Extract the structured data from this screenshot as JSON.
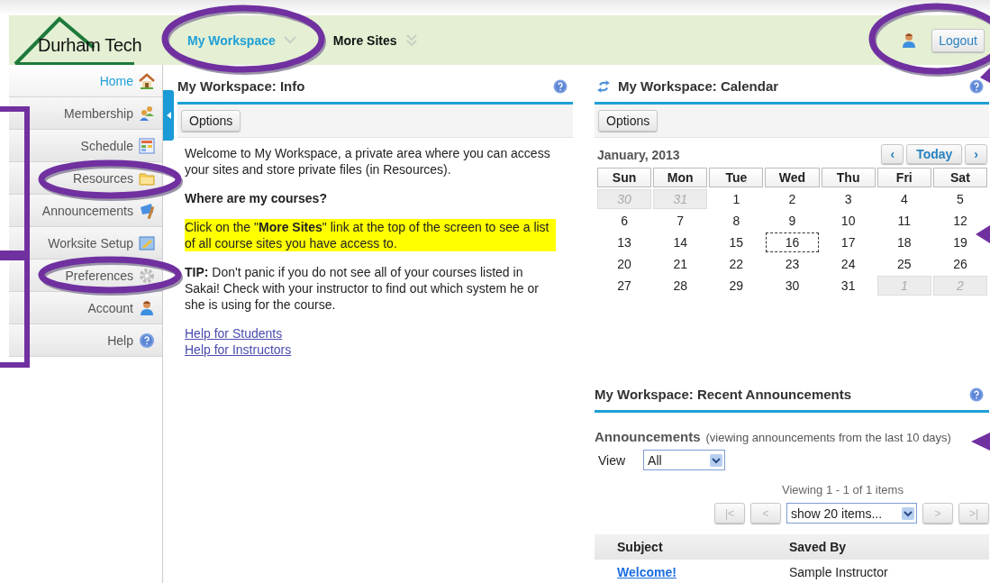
{
  "header": {
    "logo": "Durham Tech",
    "sites": [
      {
        "label": "My Workspace",
        "selected": true
      },
      {
        "label": "More Sites",
        "selected": false
      }
    ],
    "logout": "Logout"
  },
  "sidebar": {
    "items": [
      {
        "label": "Home",
        "selected": true
      },
      {
        "label": "Membership",
        "selected": false
      },
      {
        "label": "Schedule",
        "selected": false
      },
      {
        "label": "Resources",
        "selected": false
      },
      {
        "label": "Announcements",
        "selected": false
      },
      {
        "label": "Worksite Setup",
        "selected": false
      },
      {
        "label": "Preferences",
        "selected": false
      },
      {
        "label": "Account",
        "selected": false
      },
      {
        "label": "Help",
        "selected": false
      }
    ]
  },
  "info": {
    "title": "My Workspace: Info",
    "options": "Options",
    "blocks": [
      {
        "kind": "text",
        "text": "Welcome to My Workspace, a private area where you can access your sites and store private files (in Resources)."
      },
      {
        "kind": "heading",
        "text": "Where are my courses?"
      },
      {
        "kind": "highlight",
        "text": "Click on the \"**More Sites**\" link at the top of the screen to see a list of all course sites you have access to."
      },
      {
        "kind": "text",
        "text": "**TIP:** Don't panic if you do not see all of your courses listed in Sakai! Check with your instructor to find out which system he or she is using for the course."
      }
    ],
    "links": [
      "Help for Students",
      "Help for Instructors"
    ]
  },
  "calendar": {
    "title": "My Workspace: Calendar",
    "options": "Options",
    "month": "January, 2013",
    "nav": [
      "‹",
      "Today",
      "›"
    ],
    "weekdays": [
      "Sun",
      "Mon",
      "Tue",
      "Wed",
      "Thu",
      "Fri",
      "Sat"
    ],
    "weeks": [
      [
        {
          "day": "30",
          "outside": true,
          "today": false
        },
        {
          "day": "31",
          "outside": true,
          "today": false
        },
        {
          "day": "1",
          "outside": false,
          "today": false
        },
        {
          "day": "2",
          "outside": false,
          "today": false
        },
        {
          "day": "3",
          "outside": false,
          "today": false
        },
        {
          "day": "4",
          "outside": false,
          "today": false
        },
        {
          "day": "5",
          "outside": false,
          "today": false
        }
      ],
      [
        {
          "day": "6",
          "outside": false,
          "today": false
        },
        {
          "day": "7",
          "outside": false,
          "today": false
        },
        {
          "day": "8",
          "outside": false,
          "today": false
        },
        {
          "day": "9",
          "outside": false,
          "today": false
        },
        {
          "day": "10",
          "outside": false,
          "today": false
        },
        {
          "day": "11",
          "outside": false,
          "today": false
        },
        {
          "day": "12",
          "outside": false,
          "today": false
        }
      ],
      [
        {
          "day": "13",
          "outside": false,
          "today": false
        },
        {
          "day": "14",
          "outside": false,
          "today": false
        },
        {
          "day": "15",
          "outside": false,
          "today": false
        },
        {
          "day": "16",
          "outside": false,
          "today": true
        },
        {
          "day": "17",
          "outside": false,
          "today": false
        },
        {
          "day": "18",
          "outside": false,
          "today": false
        },
        {
          "day": "19",
          "outside": false,
          "today": false
        }
      ],
      [
        {
          "day": "20",
          "outside": false,
          "today": false
        },
        {
          "day": "21",
          "outside": false,
          "today": false
        },
        {
          "day": "22",
          "outside": false,
          "today": false
        },
        {
          "day": "23",
          "outside": false,
          "today": false
        },
        {
          "day": "24",
          "outside": false,
          "today": false
        },
        {
          "day": "25",
          "outside": false,
          "today": false
        },
        {
          "day": "26",
          "outside": false,
          "today": false
        }
      ],
      [
        {
          "day": "27",
          "outside": false,
          "today": false
        },
        {
          "day": "28",
          "outside": false,
          "today": false
        },
        {
          "day": "29",
          "outside": false,
          "today": false
        },
        {
          "day": "30",
          "outside": false,
          "today": false
        },
        {
          "day": "31",
          "outside": false,
          "today": false
        },
        {
          "day": "1",
          "outside": true,
          "today": false
        },
        {
          "day": "2",
          "outside": true,
          "today": false
        }
      ]
    ]
  },
  "announcements": {
    "title": "My Workspace: Recent Announcements",
    "heading": "Announcements",
    "note": "(viewing announcements from the last 10 days)",
    "view_label": "View",
    "view_value": "All",
    "viewing": "Viewing 1 - 1 of 1 items",
    "pager": [
      {
        "label": "|<",
        "disabled": true
      },
      {
        "label": "<",
        "disabled": true
      },
      {
        "label": ">",
        "disabled": true
      },
      {
        "label": ">|",
        "disabled": true
      }
    ],
    "page_size": "show 20 items...",
    "table": {
      "columns": [
        "Subject",
        "Saved By"
      ],
      "rows": [
        [
          "Welcome!",
          "Sample Instructor"
        ]
      ]
    }
  }
}
